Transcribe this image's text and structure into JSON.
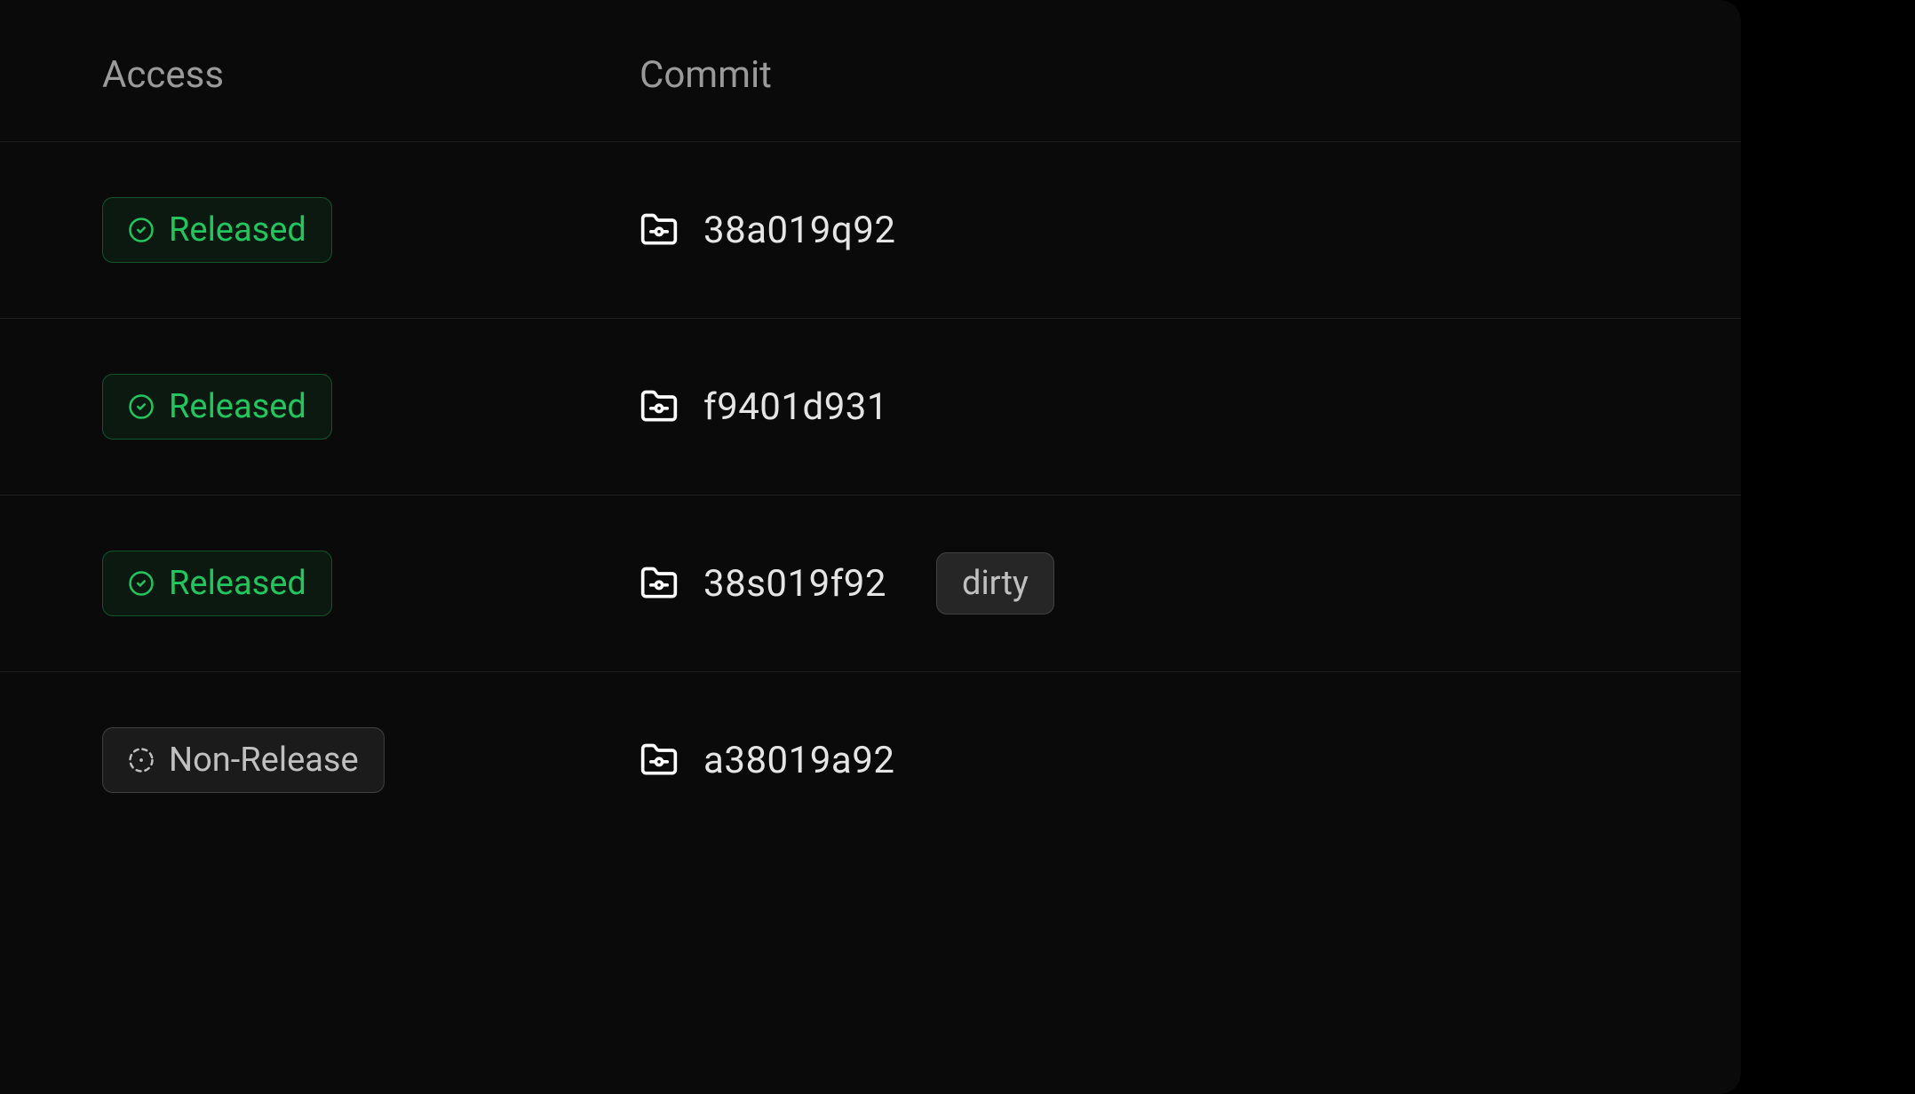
{
  "headers": {
    "access": "Access",
    "commit": "Commit"
  },
  "badges": {
    "released": "Released",
    "nonrelease": "Non-Release",
    "dirty": "dirty"
  },
  "rows": [
    {
      "access_type": "released",
      "commit": "38a019q92",
      "dirty": false
    },
    {
      "access_type": "released",
      "commit": "f9401d931",
      "dirty": false
    },
    {
      "access_type": "released",
      "commit": "38s019f92",
      "dirty": true
    },
    {
      "access_type": "nonrelease",
      "commit": "a38019a92",
      "dirty": false
    }
  ]
}
